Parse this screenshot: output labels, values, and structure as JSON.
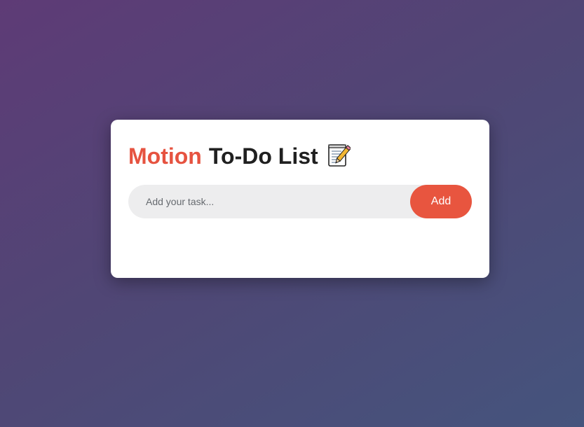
{
  "app": {
    "title_accent": "Motion",
    "title_rest": "To-Do List",
    "title_icon": "memo-icon"
  },
  "form": {
    "input_value": "",
    "input_placeholder": "Add your task...",
    "add_label": "Add"
  },
  "tasks": [],
  "colors": {
    "accent": "#e65340",
    "button": "#e8553f",
    "input_bg": "#ededee",
    "background_start": "#5e3b76",
    "background_end": "#45547d"
  }
}
